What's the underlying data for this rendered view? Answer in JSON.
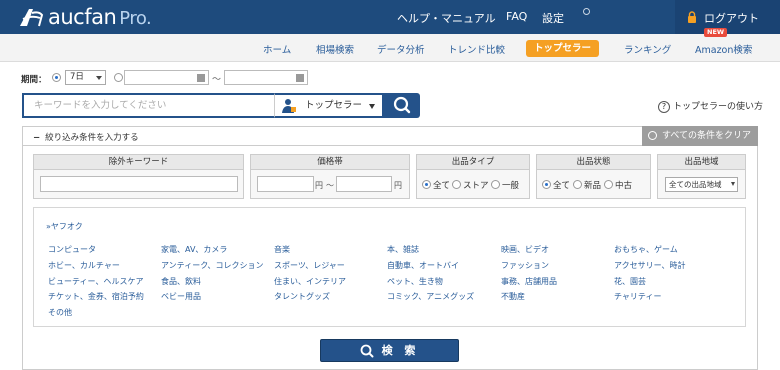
{
  "header": {
    "logo_text": "aucfan",
    "logo_suffix": "Pro.",
    "links": [
      "ヘルプ・マニュアル",
      "FAQ",
      "設定"
    ],
    "logout": "ログアウト"
  },
  "nav": {
    "items": [
      "ホーム",
      "相場検索",
      "データ分析",
      "トレンド比較",
      "トップセラー",
      "ランキング",
      "Amazon検索"
    ],
    "active": "トップセラー",
    "new_badge": "NEW"
  },
  "period": {
    "label": "期間：",
    "selected": "7日",
    "tilde": "〜"
  },
  "search": {
    "placeholder": "キーワードを入力してください",
    "mode": "トップセラー",
    "help": "トップセラーの使い方"
  },
  "filter_panel": {
    "toggle_label": "絞り込み条件を入力する",
    "toggle_icon": "−",
    "clear_label": "すべての条件をクリア",
    "exclude_keyword": "除外キーワード",
    "price_range": "価格帯",
    "price_unit": "円",
    "price_tilde": "〜",
    "listing_type": {
      "title": "出品タイプ",
      "options": [
        "全て",
        "ストア",
        "一般"
      ],
      "selected": "全て"
    },
    "condition": {
      "title": "出品状態",
      "options": [
        "全て",
        "新品",
        "中古"
      ],
      "selected": "全て"
    },
    "region": {
      "title": "出品地域",
      "selected": "全ての出品地域"
    }
  },
  "categories": {
    "title": "»ヤフオク",
    "items": [
      "コンピュータ",
      "家電、AV、カメラ",
      "音楽",
      "本、雑誌",
      "映画、ビデオ",
      "おもちゃ、ゲーム",
      "ホビー、カルチャー",
      "アンティーク、コレクション",
      "スポーツ、レジャー",
      "自動車、オートバイ",
      "ファッション",
      "アクセサリー、時計",
      "ビューティー、ヘルスケア",
      "食品、飲料",
      "住まい、インテリア",
      "ペット、生き物",
      "事務、店舗用品",
      "花、園芸",
      "チケット、金券、宿泊予約",
      "ベビー用品",
      "タレントグッズ",
      "コミック、アニメグッズ",
      "不動産",
      "チャリティー",
      "その他"
    ]
  },
  "submit": {
    "label": "検 索"
  },
  "colors": {
    "header_bg": "#1e4b7d",
    "accent_orange": "#f5a023",
    "link_blue": "#2a5d9a",
    "button_blue": "#24528a"
  }
}
